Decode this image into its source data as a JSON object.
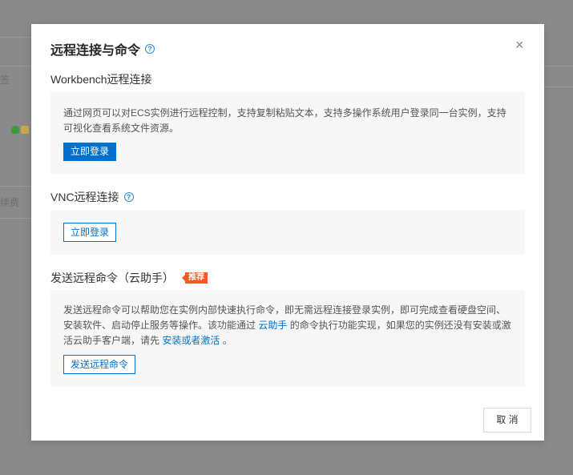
{
  "background": {
    "fragments": [
      "签",
      "续费"
    ]
  },
  "modal": {
    "title": "远程连接与命令",
    "help_glyph": "?",
    "close_glyph": "×",
    "cancel_label": "取 消"
  },
  "workbench": {
    "title": "Workbench远程连接",
    "description": "通过网页可以对ECS实例进行远程控制，支持复制粘贴文本，支持多操作系统用户登录同一台实例，支持可视化查看系统文件资源。",
    "login_label": "立即登录"
  },
  "vnc": {
    "title": "VNC远程连接",
    "help_glyph": "?",
    "login_label": "立即登录"
  },
  "command": {
    "title": "发送远程命令（云助手）",
    "badge": "推荐",
    "desc_part1": "发送远程命令可以帮助您在实例内部快速执行命令，即无需远程连接登录实例，即可完成查看硬盘空间、安装软件、启动停止服务等操作。该功能通过 ",
    "desc_link1": "云助手",
    "desc_part2": " 的命令执行功能实现，如果您的实例还没有安装或激活云助手客户端，请先 ",
    "desc_link2": "安装或者激活",
    "desc_part3": " 。",
    "send_label": "发送远程命令"
  },
  "colors": {
    "primary": "#0070cc",
    "badge": "#f15a24",
    "overlay": "#8a8a8a"
  }
}
